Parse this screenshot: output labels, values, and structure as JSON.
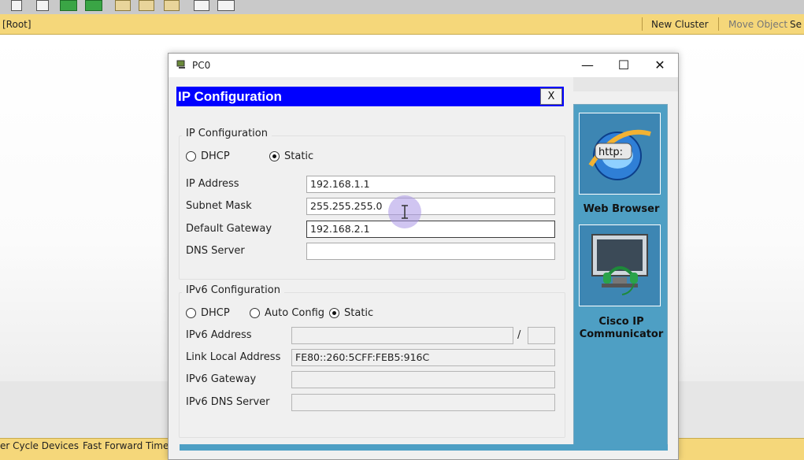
{
  "background_app": {
    "location_label": "[Root]",
    "new_cluster": "New Cluster",
    "move_object": "Move Object",
    "set_tiled_partial": "Se",
    "bottom_left_text": "er Cycle Devices",
    "fast_forward": "Fast Forward Time"
  },
  "window": {
    "title": "PC0",
    "minimize": "—",
    "maximize": "☐",
    "close": "✕"
  },
  "ip_config": {
    "header_title": "IP Configuration",
    "close_label": "X",
    "ipv4": {
      "legend": "IP Configuration",
      "dhcp_label": "DHCP",
      "static_label": "Static",
      "selected": "Static",
      "ip_address_label": "IP Address",
      "ip_address": "192.168.1.1",
      "subnet_mask_label": "Subnet Mask",
      "subnet_mask": "255.255.255.0",
      "default_gateway_label": "Default Gateway",
      "default_gateway": "192.168.2.1",
      "dns_server_label": "DNS Server",
      "dns_server": ""
    },
    "ipv6": {
      "legend": "IPv6 Configuration",
      "dhcp_label": "DHCP",
      "auto_config_label": "Auto Config",
      "static_label": "Static",
      "selected": "Static",
      "ipv6_address_label": "IPv6 Address",
      "ipv6_address": "",
      "slash": "/",
      "prefix_length": "",
      "link_local_label": "Link Local Address",
      "link_local": "FE80::260:5CFF:FEB5:916C",
      "ipv6_gateway_label": "IPv6 Gateway",
      "ipv6_gateway": "",
      "ipv6_dns_label": "IPv6 DNS Server",
      "ipv6_dns": ""
    }
  },
  "apps": [
    {
      "label": "Web Browser",
      "icon": "web-browser-icon",
      "icon_text": "http:"
    },
    {
      "label": "Cisco IP Communicator",
      "icon": "ip-communicator-icon"
    }
  ],
  "colors": {
    "header_blue": "#0000ff",
    "app_panel": "#4e9fc4",
    "toolbar_yellow": "#f5d77a"
  }
}
